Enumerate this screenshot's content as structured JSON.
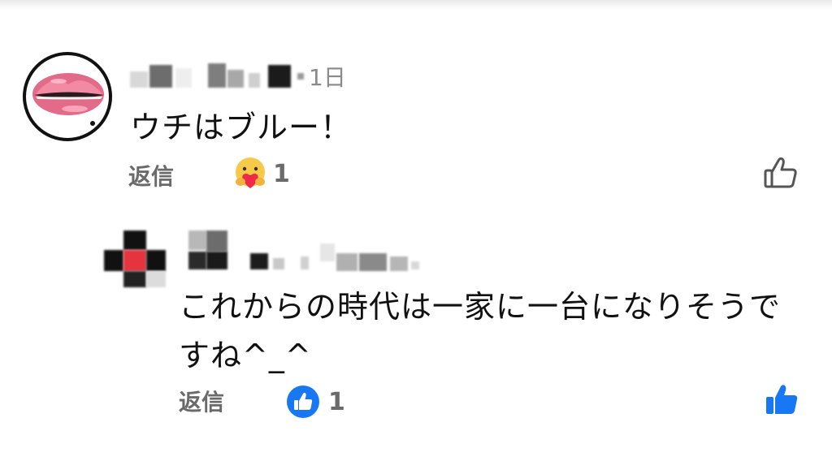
{
  "comments": [
    {
      "timestamp": "1日",
      "text": "ウチはブルー！",
      "reply_label": "返信",
      "reaction": {
        "icon": "care-hug-emoji-icon",
        "count": "1"
      },
      "like_icon": "thumbs-up-outline-icon",
      "like_color": "#555555"
    },
    {
      "text": "これからの時代は一家に一台になりそうですね^_^",
      "reply_label": "返信",
      "reaction": {
        "icon": "like-badge-icon",
        "count": "1",
        "color": "#1877f2"
      },
      "like_icon": "thumbs-up-filled-icon",
      "like_color": "#1877f2"
    }
  ]
}
